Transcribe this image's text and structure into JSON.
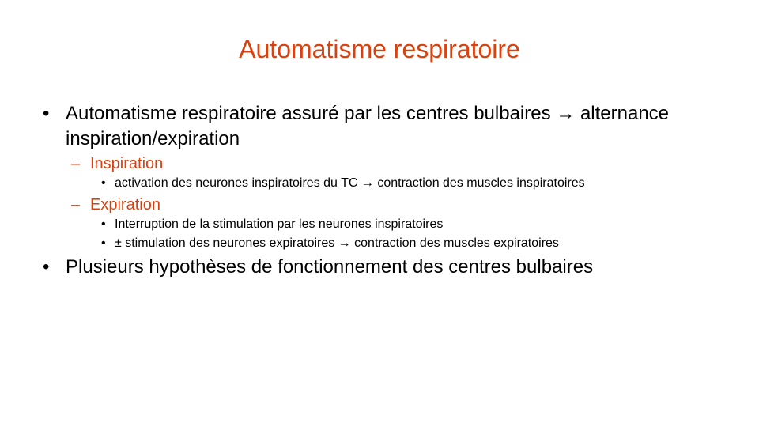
{
  "slide": {
    "title": "Automatisme respiratoire",
    "accent_color": "#d9410e",
    "bullet_glyph": "•",
    "dash_glyph": "–",
    "points": [
      {
        "text": "Automatisme respiratoire assuré par les centres bulbaires → alternance inspiration/expiration",
        "subpoints": [
          {
            "text": "Inspiration",
            "items": [
              "activation des neurones inspiratoires du TC → contraction des muscles inspiratoires"
            ]
          },
          {
            "text": "Expiration",
            "items": [
              "Interruption de la stimulation par les neurones inspiratoires",
              "± stimulation des neurones expiratoires → contraction des muscles expiratoires"
            ]
          }
        ]
      },
      {
        "text": "Plusieurs hypothèses de fonctionnement des centres bulbaires"
      }
    ]
  }
}
